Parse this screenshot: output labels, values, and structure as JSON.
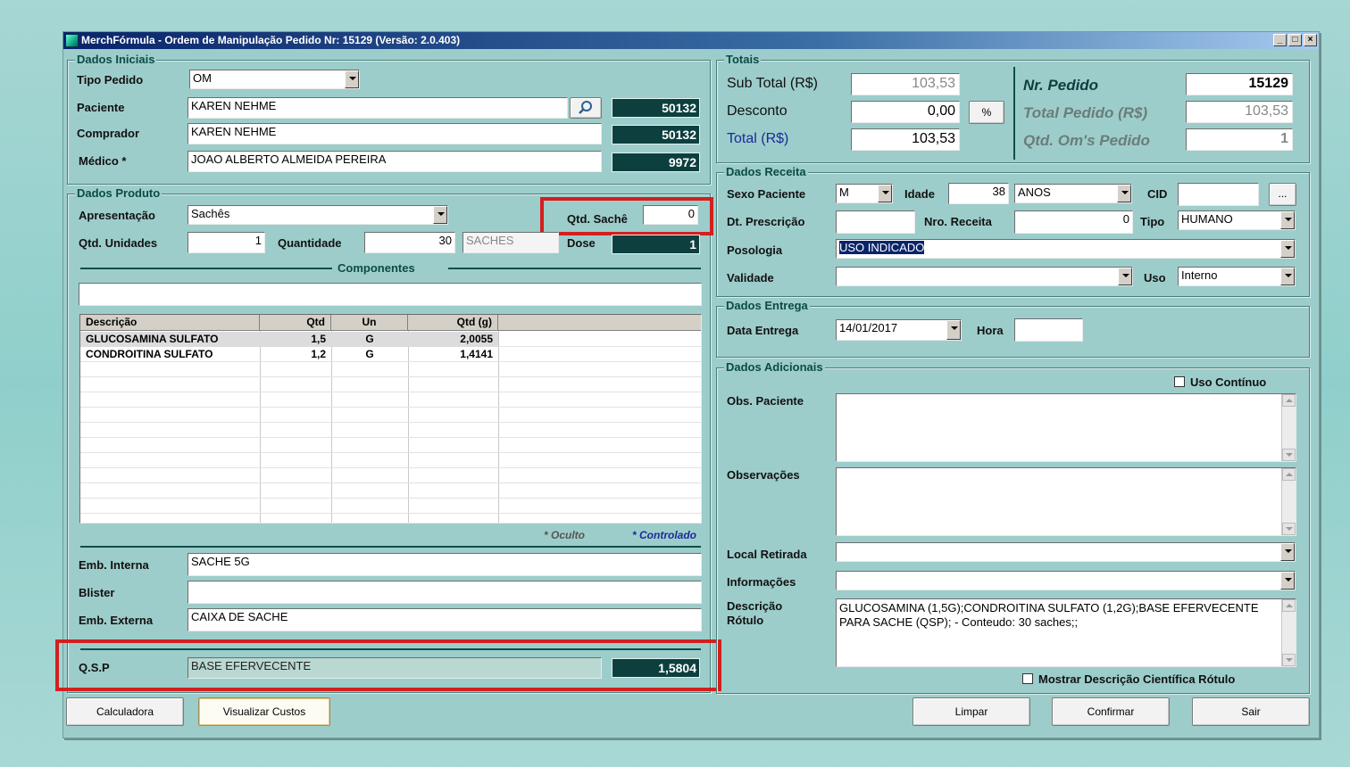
{
  "window": {
    "title": "MerchFórmula - Ordem de Manipulação Pedido Nr: 15129 (Versão: 2.0.403)",
    "buttons": [
      "_",
      "□",
      "×"
    ]
  },
  "dados_iniciais": {
    "title": "Dados Iniciais",
    "tipo_pedido_label": "Tipo Pedido",
    "tipo_pedido_value": "OM",
    "paciente_label": "Paciente",
    "paciente_value": "KAREN NEHME",
    "paciente_code": "50132",
    "comprador_label": "Comprador",
    "comprador_value": "KAREN NEHME",
    "comprador_code": "50132",
    "medico_label": "Médico *",
    "medico_value": "JOAO ALBERTO ALMEIDA PEREIRA",
    "medico_code": "9972"
  },
  "dados_produto": {
    "title": "Dados Produto",
    "apresentacao_label": "Apresentação",
    "apresentacao_value": "Sachês",
    "qtd_sache_label": "Qtd. Sachê",
    "qtd_sache_value": "0",
    "qtd_unidades_label": "Qtd. Unidades",
    "qtd_unidades_value": "1",
    "quantidade_label": "Quantidade",
    "quantidade_value": "30",
    "quantidade_unit": "SACHES",
    "dose_label": "Dose",
    "dose_value": "1",
    "componentes_label": "Componentes",
    "grid_headers": [
      "Descrição",
      "Qtd",
      "Un",
      "Qtd (g)"
    ],
    "grid_rows": [
      {
        "descricao": "GLUCOSAMINA SULFATO",
        "qtd": "1,5",
        "un": "G",
        "qtd_g": "2,0055"
      },
      {
        "descricao": "CONDROITINA SULFATO",
        "qtd": "1,2",
        "un": "G",
        "qtd_g": "1,4141"
      }
    ],
    "oculto_label": "* Oculto",
    "controlado_label": "* Controlado",
    "emb_interna_label": "Emb. Interna",
    "emb_interna_value": "SACHE 5G",
    "blister_label": "Blister",
    "blister_value": "",
    "emb_externa_label": "Emb. Externa",
    "emb_externa_value": "CAIXA DE SACHE",
    "qsp_label": "Q.S.P",
    "qsp_value": "BASE EFERVECENTE",
    "qsp_amount": "1,5804"
  },
  "totais": {
    "title": "Totais",
    "subtotal_label": "Sub Total (R$)",
    "subtotal_value": "103,53",
    "desconto_label": "Desconto",
    "desconto_value": "0,00",
    "percent_button": "%",
    "total_label": "Total (R$)",
    "total_value": "103,53",
    "nr_pedido_label": "Nr. Pedido",
    "nr_pedido_value": "15129",
    "total_pedido_label": "Total Pedido (R$)",
    "total_pedido_value": "103,53",
    "qtd_oms_label": "Qtd. Om's Pedido",
    "qtd_oms_value": "1"
  },
  "dados_receita": {
    "title": "Dados Receita",
    "sexo_label": "Sexo Paciente",
    "sexo_value": "M",
    "idade_label": "Idade",
    "idade_value": "38",
    "idade_unit": "ANOS",
    "cid_label": "CID",
    "cid_value": "",
    "cid_button": "...",
    "dt_prescricao_label": "Dt. Prescrição",
    "dt_prescricao_value": "",
    "nro_receita_label": "Nro. Receita",
    "nro_receita_value": "0",
    "tipo_label": "Tipo",
    "tipo_value": "HUMANO",
    "posologia_label": "Posologia",
    "posologia_value": "USO INDICADO",
    "validade_label": "Validade",
    "validade_value": "",
    "uso_label": "Uso",
    "uso_value": "Interno"
  },
  "dados_entrega": {
    "title": "Dados Entrega",
    "data_label": "Data Entrega",
    "data_value": "14/01/2017",
    "hora_label": "Hora",
    "hora_value": ""
  },
  "dados_adicionais": {
    "title": "Dados Adicionais",
    "uso_continuo_label": "Uso Contínuo",
    "obs_paciente_label": "Obs. Paciente",
    "observacoes_label": "Observações",
    "local_retirada_label": "Local Retirada",
    "informacoes_label": "Informações",
    "descricao_rotulo_label_1": "Descrição",
    "descricao_rotulo_label_2": "Rótulo",
    "descricao_rotulo_value": "GLUCOSAMINA (1,5G);CONDROITINA SULFATO (1,2G);BASE EFERVECENTE PARA SACHE (QSP); -  Conteudo: 30 saches;;",
    "mostrar_label": "Mostrar Descrição Científica Rótulo"
  },
  "footer": {
    "calculadora": "Calculadora",
    "visualizar_custos": "Visualizar Custos",
    "limpar": "Limpar",
    "confirmar": "Confirmar",
    "sair": "Sair"
  },
  "colors": {
    "highlight": "#d21f1f",
    "dark_field": "#0e3f3f",
    "panel": "#9dcdca"
  }
}
